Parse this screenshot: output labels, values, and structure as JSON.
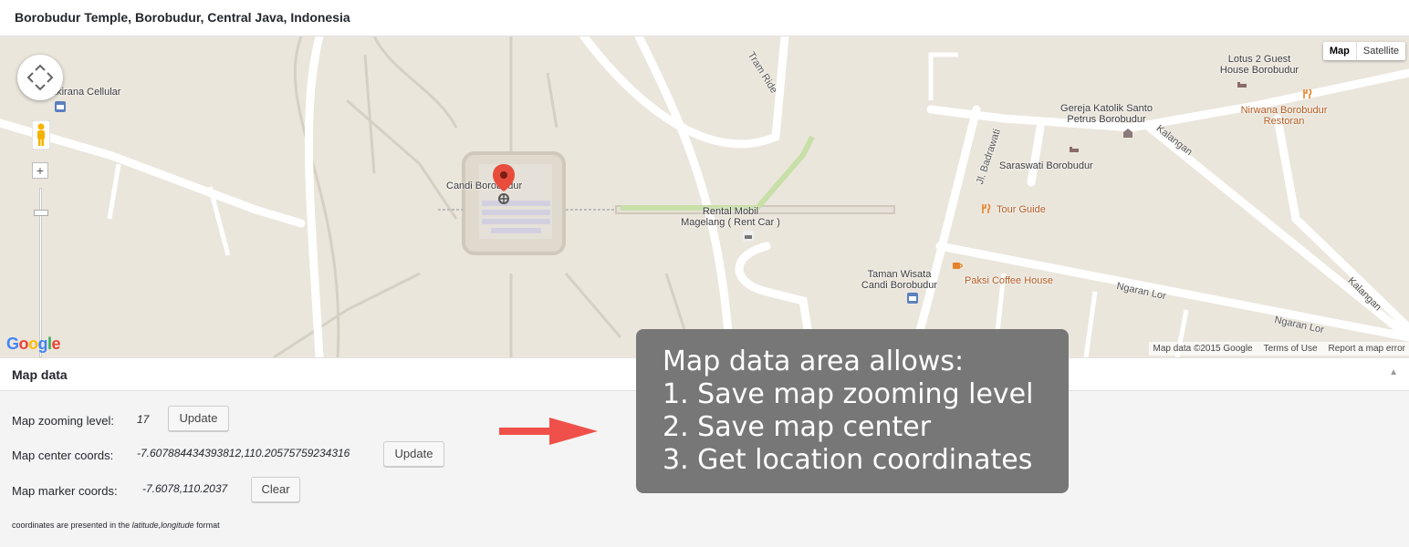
{
  "window": {
    "title": "Borobudur Temple, Borobudur, Central Java, Indonesia"
  },
  "map": {
    "type_controls": {
      "map": "Map",
      "satellite": "Satellite",
      "active": "Map"
    },
    "labels": {
      "cellular": "akirana Cellular",
      "candi": "Candi Borobudur",
      "rental1": "Rental Mobil",
      "rental2": "Magelang ( Rent Car )",
      "lotus1": "Lotus 2 Guest",
      "lotus2": "House Borobudur",
      "gereja1": "Gereja Katolik Santo",
      "gereja2": "Petrus Borobudur",
      "nirwana1": "Nirwana Borobudur",
      "nirwana2": "Restoran",
      "saraswati": "Saraswati Borobudur",
      "tour": "Tour Guide",
      "taman1": "Taman Wisata",
      "taman2": "Candi Borobudur",
      "paksi": "Paksi Coffee House"
    },
    "roads": {
      "tram": "Tram Ride",
      "badrawati": "Jl. Badrawati",
      "kalangan": "Kalangan",
      "ngaran1": "Ngaran Lor",
      "ngaran2": "Ngaran Lor",
      "kalangan2": "Kalangan"
    },
    "google_logo": "Google",
    "attribution": {
      "data": "Map data ©2015 Google",
      "terms": "Terms of Use",
      "report": "Report a map error"
    },
    "zoom": {
      "plus": "+",
      "minus": "−"
    }
  },
  "panel": {
    "title": "Map data",
    "toggle": "▲",
    "rows": [
      {
        "label": "Map zooming level:",
        "value": "17",
        "button": "Update"
      },
      {
        "label": "Map center coords:",
        "value": "-7.607884434393812,110.20575759234316",
        "button": "Update"
      },
      {
        "label": "Map marker coords:",
        "value": "-7.6078,110.2037",
        "button": "Clear"
      }
    ],
    "note_prefix": "coordinates are presented in the ",
    "note_em": "latitude,longitude",
    "note_suffix": " format"
  },
  "tooltip": {
    "lines": [
      "Map data area allows:",
      "1. Save map zooming level",
      "2. Save map center",
      "3. Get location coordinates"
    ]
  },
  "colors": {
    "accent_arrow": "#f0504a",
    "tooltip_bg": "#777777",
    "map_bg": "#ebe6dc",
    "road": "#ffffff",
    "park": "#c8dfa8"
  }
}
